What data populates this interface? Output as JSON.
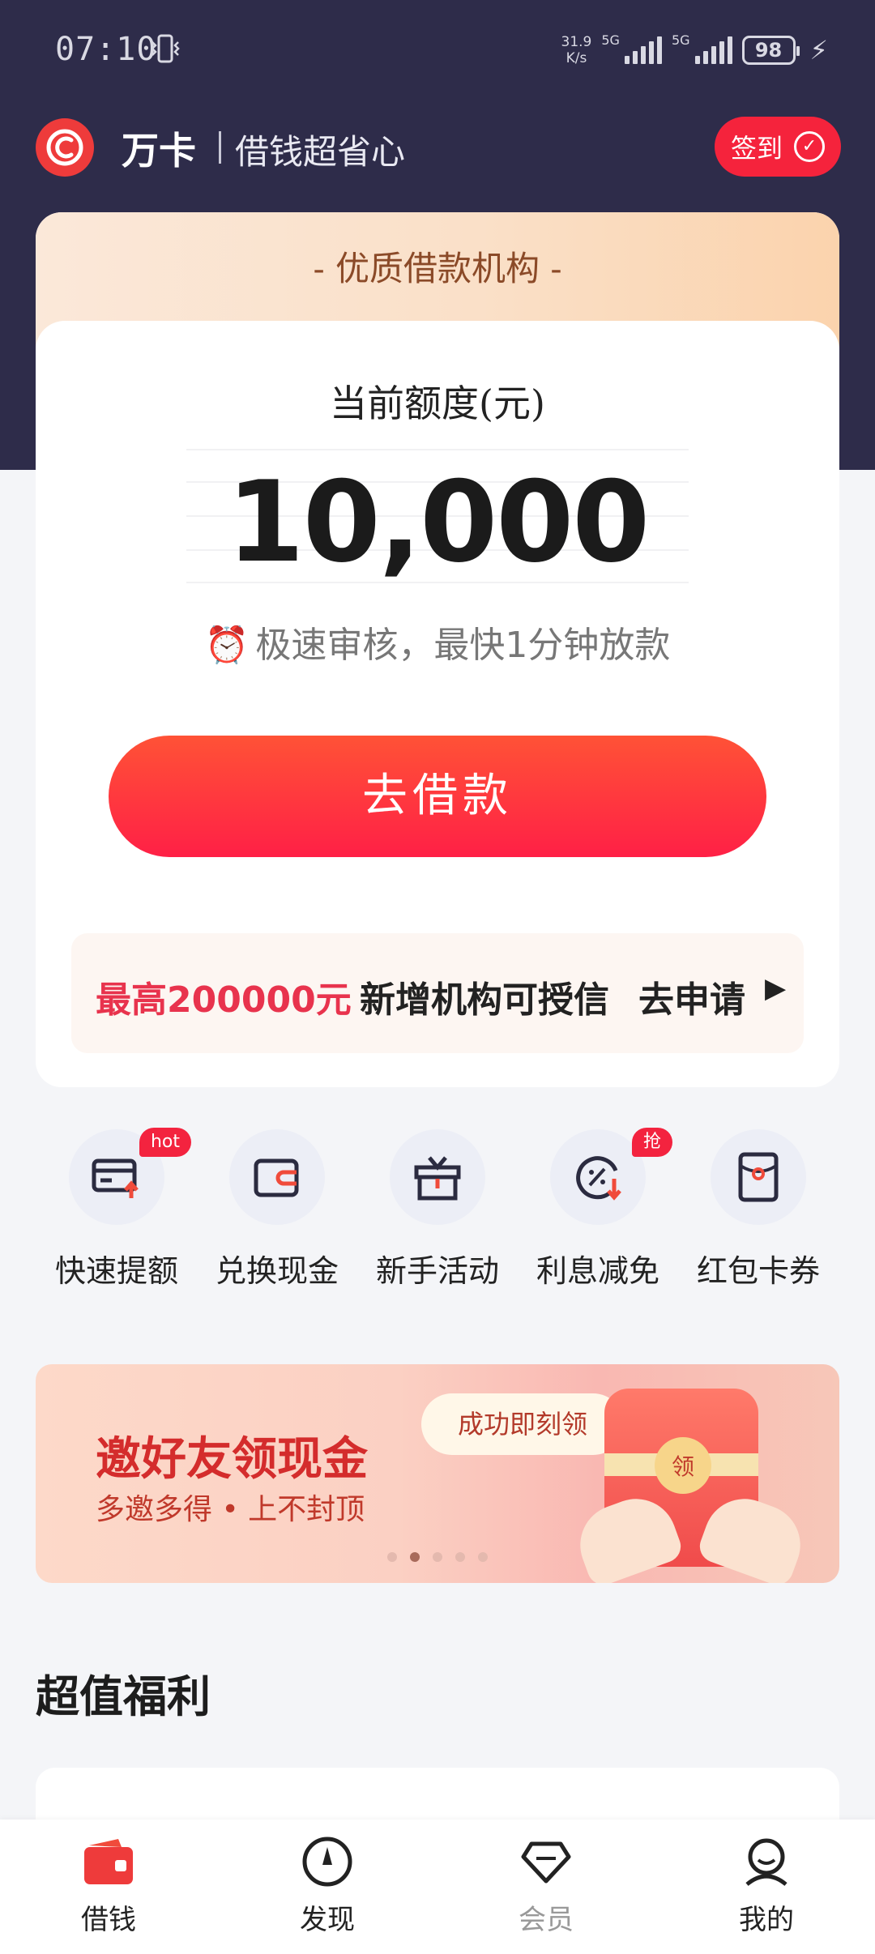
{
  "status_bar": {
    "time": "07:10",
    "net_speed_value": "31.9",
    "net_speed_unit": "K/s",
    "net_1": "5G",
    "net_2": "5G",
    "battery": "98"
  },
  "header": {
    "brand_name": "万卡",
    "slogan": "借钱超省心",
    "checkin_label": "签到"
  },
  "credit_card": {
    "banner_title": "- 优质借款机构 -",
    "limit_label": "当前额度(元)",
    "limit_amount": "10,000",
    "speed_note": "极速审核，最快1分钟放款",
    "borrow_button": "去借款",
    "promo_highlight": "最高200000元",
    "promo_text": "新增机构可授信",
    "promo_apply": "去申请"
  },
  "shortcuts": [
    {
      "label": "快速提额",
      "icon": "card-upgrade-icon",
      "badge": "hot"
    },
    {
      "label": "兑换现金",
      "icon": "wallet-icon",
      "badge": ""
    },
    {
      "label": "新手活动",
      "icon": "gift-icon",
      "badge": ""
    },
    {
      "label": "利息减免",
      "icon": "discount-icon",
      "badge": "抢"
    },
    {
      "label": "红包卡券",
      "icon": "red-envelope-icon",
      "badge": ""
    }
  ],
  "promo_banner": {
    "title": "邀好友领现金",
    "subtitle": "多邀多得 • 上不封顶",
    "bubble": "成功即刻领",
    "seal_text": "领",
    "slide_count": 5,
    "active_slide": 2
  },
  "section": {
    "title": "超值福利"
  },
  "bottom_nav": [
    {
      "label": "借钱",
      "icon": "wallet-icon",
      "active": true
    },
    {
      "label": "发现",
      "icon": "compass-icon",
      "active": false
    },
    {
      "label": "会员",
      "icon": "diamond-icon",
      "active": false
    },
    {
      "label": "我的",
      "icon": "user-icon",
      "active": false
    }
  ],
  "colors": {
    "header_bg": "#2e2c4a",
    "accent_red": "#f5233c",
    "page_bg": "#f4f5f8"
  }
}
